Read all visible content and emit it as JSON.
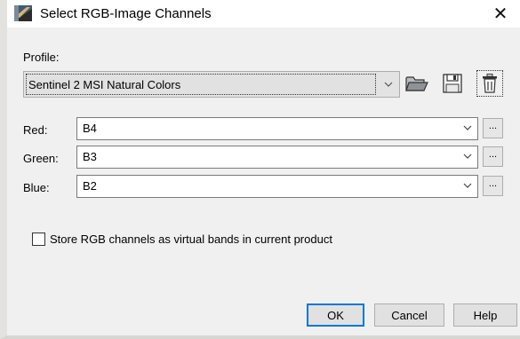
{
  "window": {
    "title": "Select RGB-Image Channels",
    "close_label": "✕"
  },
  "profile": {
    "label": "Profile:",
    "selected": "Sentinel 2 MSI Natural Colors"
  },
  "channels": [
    {
      "label": "Red:",
      "value": "B4",
      "more_label": "..."
    },
    {
      "label": "Green:",
      "value": "B3",
      "more_label": "..."
    },
    {
      "label": "Blue:",
      "value": "B2",
      "more_label": "..."
    }
  ],
  "options": {
    "store_virtual_label": "Store RGB channels as virtual bands in current product",
    "store_virtual_checked": false
  },
  "buttons": {
    "ok": "OK",
    "cancel": "Cancel",
    "help": "Help"
  },
  "icons": {
    "app": "snap-app-icon",
    "open": "folder-open-icon",
    "save": "floppy-save-icon",
    "delete": "trash-icon",
    "dropdown": "chevron-down-icon"
  }
}
